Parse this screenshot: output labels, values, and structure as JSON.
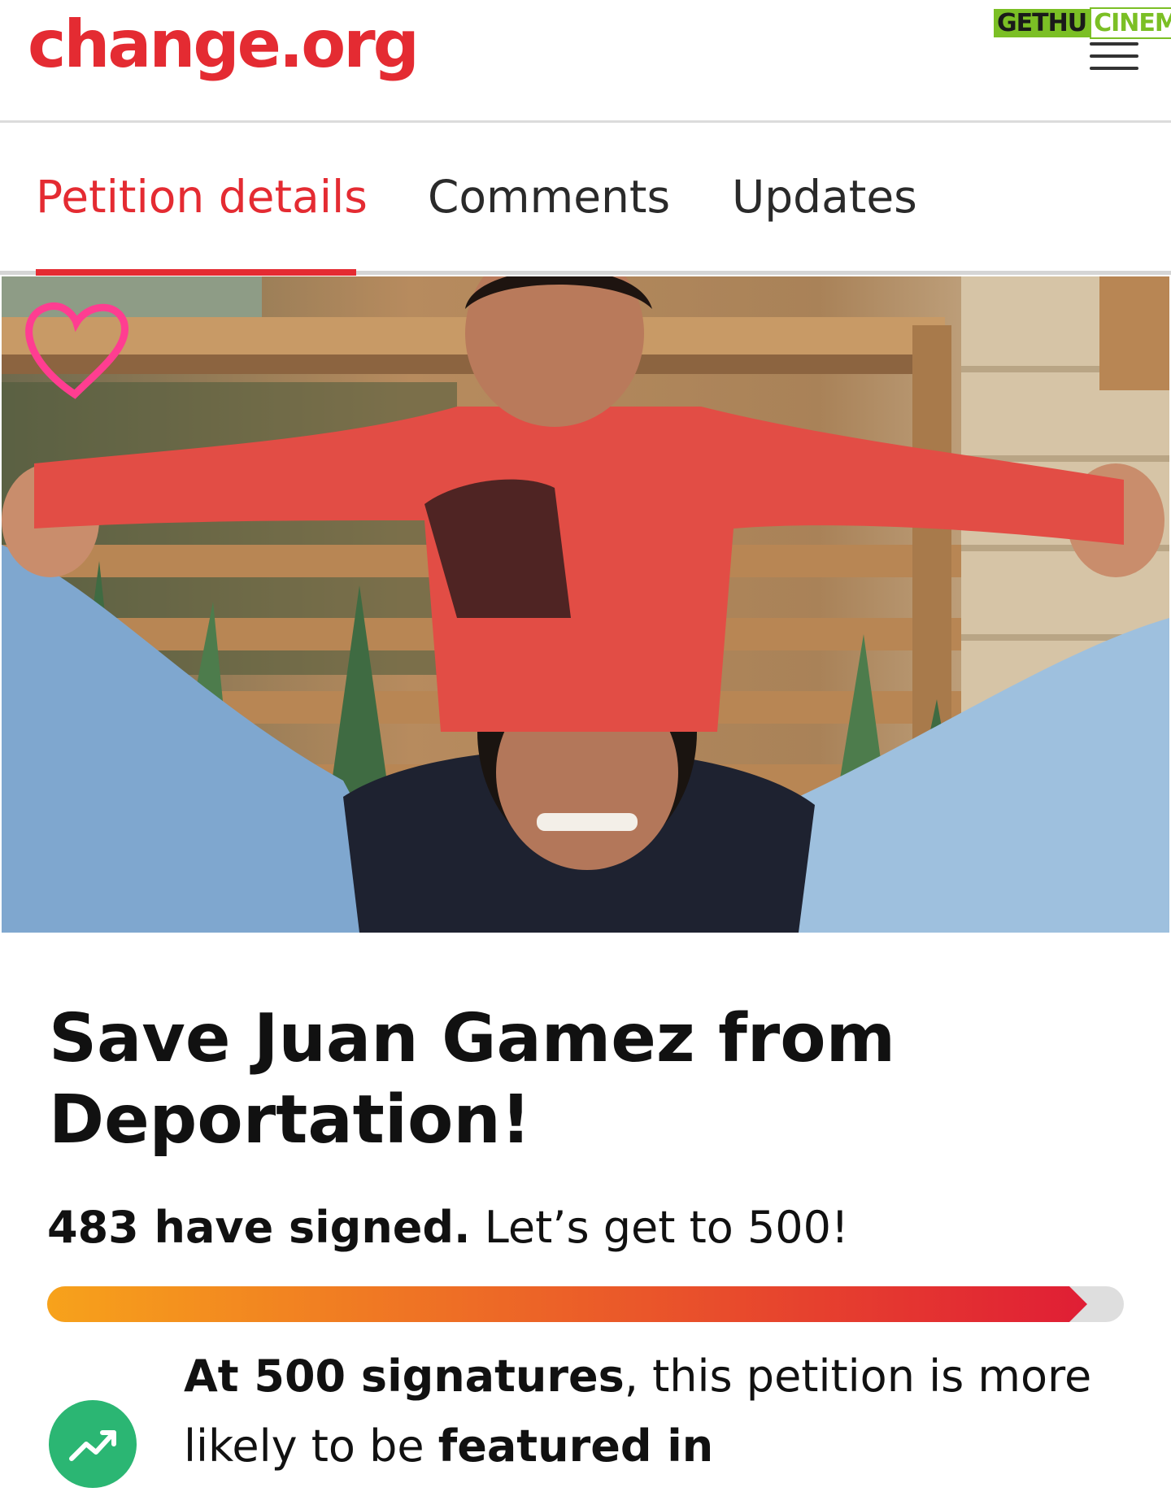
{
  "header": {
    "logo": "change.org",
    "watermark_part1": "GETHU",
    "watermark_part2": "CINEMA",
    "menu_icon": "hamburger-menu-icon"
  },
  "tabs": [
    {
      "label": "Petition details",
      "active": true
    },
    {
      "label": "Comments",
      "active": false
    },
    {
      "label": "Updates",
      "active": false
    }
  ],
  "hero": {
    "icon": "heart-icon"
  },
  "petition": {
    "title": "Save Juan Gamez from Deportation!",
    "signed_bold": "483 have signed.",
    "signed_rest": " Let’s get to 500!",
    "signatures": 483,
    "goal": 500
  },
  "info": {
    "icon": "trending-up-icon",
    "bold1": "At 500 signatures",
    "text1": ", this petition is more likely to be ",
    "bold2": "featured in"
  },
  "colors": {
    "brand_red": "#e42b32",
    "progress_start": "#f7a21b",
    "progress_end": "#e01e35",
    "info_icon_green": "#2bb673"
  }
}
